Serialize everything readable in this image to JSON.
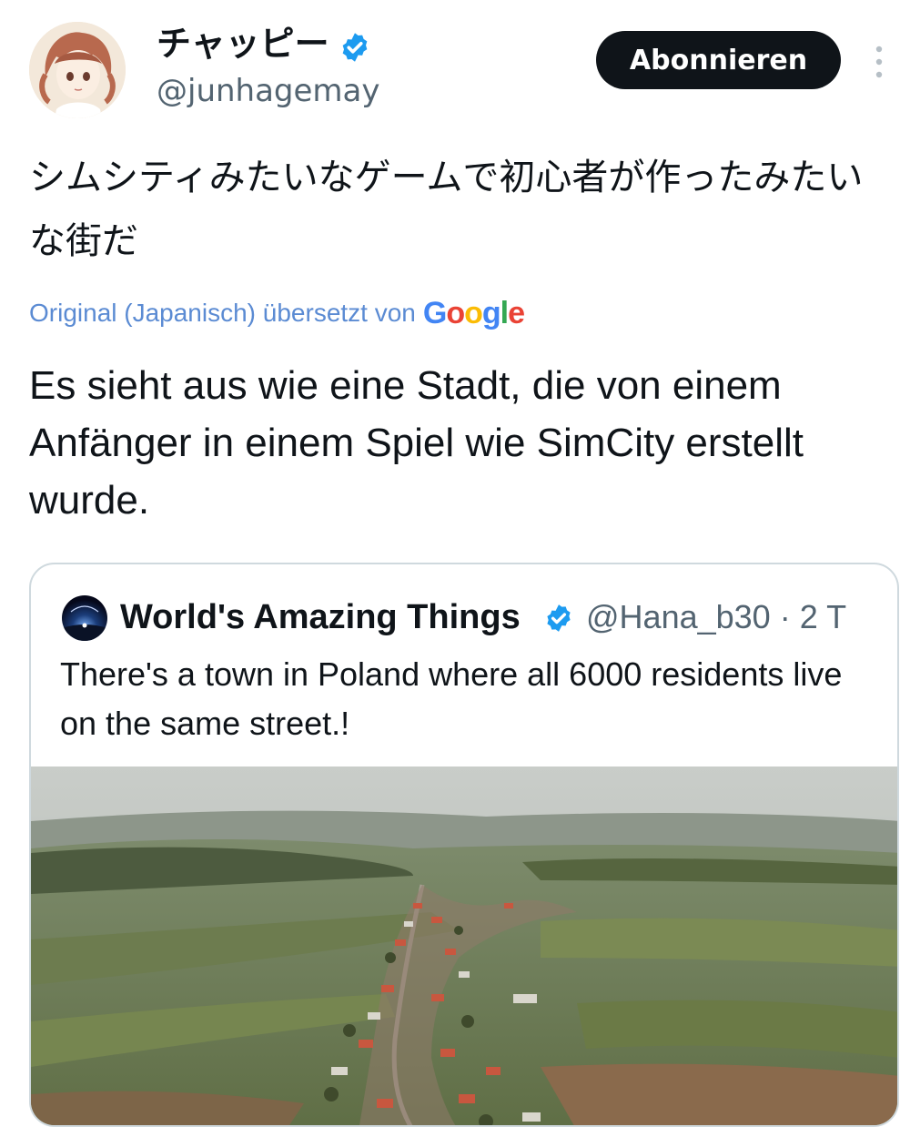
{
  "author": {
    "display_name": "チャッピー",
    "handle": "@junhagemay",
    "verified": true,
    "verified_color": "#1d9bf0"
  },
  "follow_button": {
    "label": "Abonnieren"
  },
  "more_menu": {
    "icon": "more-vertical-icon"
  },
  "tweet": {
    "original_text": "シムシティみたいなゲームで初心者が作ったみたいな街だ",
    "translation_notice": "Original (Japanisch) übersetzt von",
    "translation_provider": "Google",
    "translated_text": "Es sieht aus wie eine Stadt, die von einem Anfänger in einem Spiel wie SimCity erstellt wurde."
  },
  "quoted_tweet": {
    "display_name": "World's Amazing Things",
    "verified": true,
    "handle": "@Hana_b30",
    "time": "· 2 T",
    "text": "There's a town in Poland where all 6000 residents live on the same street.!",
    "media": "aerial-village-photo"
  },
  "colors": {
    "text": "#0f1419",
    "secondary": "#536471",
    "link": "#5b8bd3",
    "button_bg": "#0f1419",
    "border": "#cfd9de"
  }
}
